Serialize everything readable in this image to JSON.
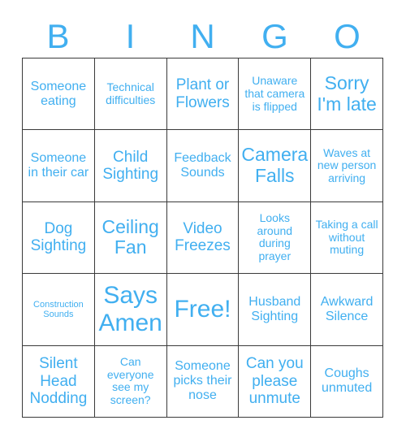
{
  "card": {
    "title": "BINGO",
    "accent_color": "#41AFF0",
    "border_color": "#3a3a3a",
    "background_color": "#ffffff"
  },
  "header": {
    "letters": [
      {
        "label": "B"
      },
      {
        "label": "I"
      },
      {
        "label": "N"
      },
      {
        "label": "G"
      },
      {
        "label": "O"
      }
    ]
  },
  "grid": {
    "rows": 5,
    "columns": 5,
    "free_space_index": 12,
    "cells": [
      {
        "text": "Someone eating",
        "size": "md"
      },
      {
        "text": "Technical difficulties",
        "size": "sm"
      },
      {
        "text": "Plant or Flowers",
        "size": "lg"
      },
      {
        "text": "Unaware that camera is flipped",
        "size": "sm"
      },
      {
        "text": "Sorry I'm late",
        "size": "xl"
      },
      {
        "text": "Someone in their car",
        "size": "md"
      },
      {
        "text": "Child Sighting",
        "size": "lg"
      },
      {
        "text": "Feedback Sounds",
        "size": "md"
      },
      {
        "text": "Camera Falls",
        "size": "xl"
      },
      {
        "text": "Waves at new person arriving",
        "size": "sm"
      },
      {
        "text": "Dog Sighting",
        "size": "lg"
      },
      {
        "text": "Ceiling Fan",
        "size": "xl"
      },
      {
        "text": "Video Freezes",
        "size": "lg"
      },
      {
        "text": "Looks around during prayer",
        "size": "sm"
      },
      {
        "text": "Taking a call without muting",
        "size": "sm"
      },
      {
        "text": "Construction Sounds",
        "size": "xs"
      },
      {
        "text": "Says Amen",
        "size": "xxl"
      },
      {
        "text": "Free!",
        "size": "xxl"
      },
      {
        "text": "Husband Sighting",
        "size": "md"
      },
      {
        "text": "Awkward Silence",
        "size": "md"
      },
      {
        "text": "Silent Head Nodding",
        "size": "lg"
      },
      {
        "text": "Can everyone see my screen?",
        "size": "sm"
      },
      {
        "text": "Someone picks their nose",
        "size": "md"
      },
      {
        "text": "Can you please unmute",
        "size": "lg"
      },
      {
        "text": "Coughs unmuted",
        "size": "md"
      }
    ]
  }
}
